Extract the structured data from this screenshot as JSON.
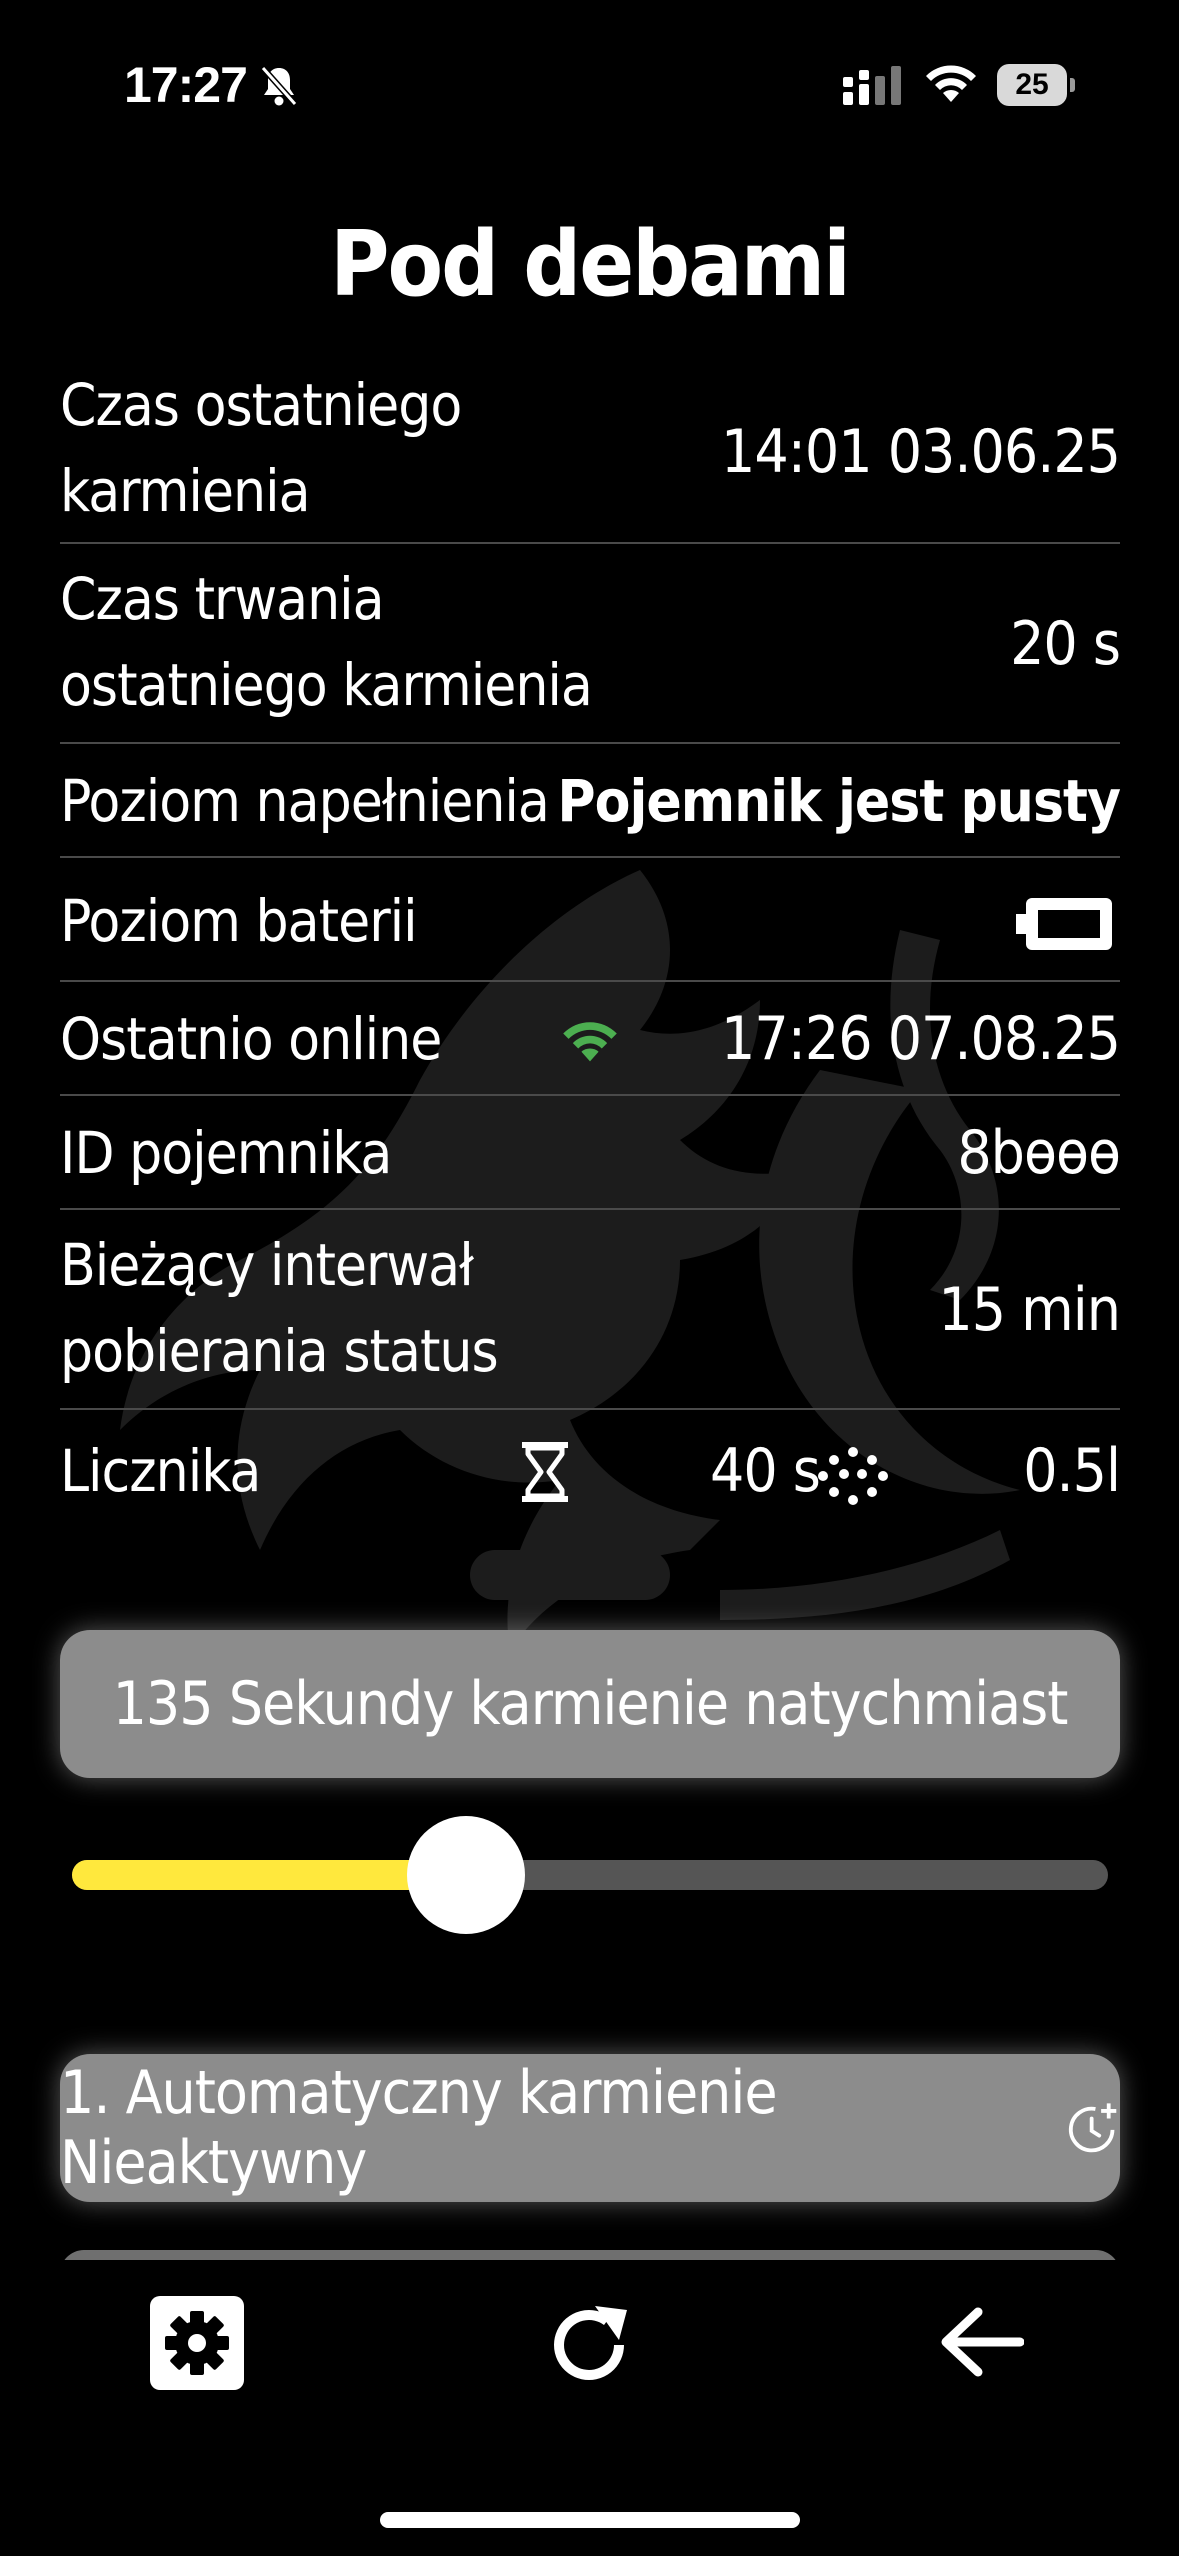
{
  "status_bar": {
    "time": "17:27",
    "battery_percent": "25",
    "icons": [
      "bell-slash-icon",
      "cellular-signal-icon",
      "wifi-icon",
      "battery-icon"
    ]
  },
  "title": "Pod debami",
  "rows": {
    "last_feed_time": {
      "label": "Czas ostatniego karmienia",
      "value": "14:01 03.06.25"
    },
    "last_feed_duration": {
      "label": "Czas trwania ostatniego karmienia",
      "value": "20 s"
    },
    "fill_level": {
      "label": "Poziom napełnienia",
      "value": "Pojemnik jest pusty"
    },
    "battery_level": {
      "label": "Poziom baterii",
      "icon": "battery-empty-icon"
    },
    "last_online": {
      "label": "Ostatnio online",
      "value": "17:26 07.08.25",
      "icon": "wifi-icon",
      "icon_color": "#4caf50"
    },
    "container_id": {
      "label": "ID pojemnika",
      "value": "8bөөө"
    },
    "status_interval": {
      "label": "Bieżący interwał pobierania status",
      "value": "15 min"
    },
    "counter": {
      "label": "Licznika",
      "time_value": "40 s",
      "volume_value": "0.5l",
      "icons": [
        "hourglass-icon",
        "spray-icon"
      ]
    }
  },
  "feed_now_button": {
    "label": "135 Sekundy karmienie natychmiast"
  },
  "slider": {
    "value_fraction": 0.38,
    "fill_color": "#ffe83d"
  },
  "auto_feed_button": {
    "label": "1. Automatyczny karmienie Nieaktywny",
    "icon": "clock-plus-icon"
  },
  "nav": {
    "items": [
      "settings-icon",
      "refresh-icon",
      "back-arrow-icon"
    ]
  }
}
